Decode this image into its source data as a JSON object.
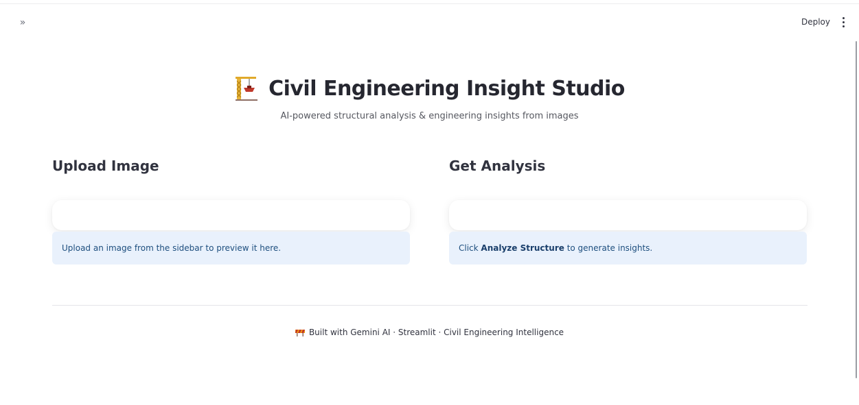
{
  "toolbar": {
    "sidebar_toggle_glyph": "»",
    "deploy_label": "Deploy"
  },
  "header": {
    "icon": "construction-crane-icon",
    "title": "Civil Engineering Insight Studio",
    "subtitle": "AI-powered structural analysis & engineering insights from images"
  },
  "upload": {
    "heading": "Upload Image",
    "info_text": "Upload an image from the sidebar to preview it here."
  },
  "analysis": {
    "heading": "Get Analysis",
    "info_prefix": "Click ",
    "info_bold": "Analyze Structure",
    "info_suffix": " to generate insights."
  },
  "footer": {
    "icon": "construction-barrier-icon",
    "text": "Built with Gemini AI · Streamlit · Civil Engineering Intelligence"
  },
  "colors": {
    "info_background": "#e9f1fc",
    "info_text": "#1d4e7e",
    "title_text": "#262730"
  }
}
